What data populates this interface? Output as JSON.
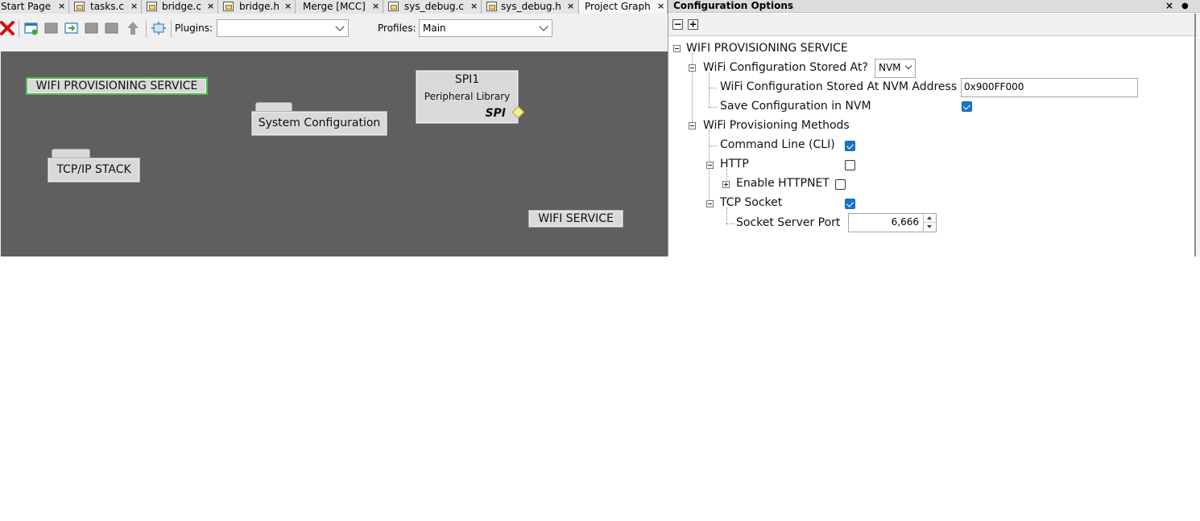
{
  "tabs": [
    {
      "label": "Start Page",
      "icon": "none",
      "active": false
    },
    {
      "label": "tasks.c",
      "icon": "c-file-icon",
      "active": false
    },
    {
      "label": "bridge.c",
      "icon": "c-file-icon",
      "active": false
    },
    {
      "label": "bridge.h",
      "icon": "h-file-icon",
      "active": false
    },
    {
      "label": "Merge [MCC]",
      "icon": "none",
      "active": false
    },
    {
      "label": "sys_debug.c",
      "icon": "c-file-icon",
      "active": false
    },
    {
      "label": "sys_debug.h",
      "icon": "h-file-icon",
      "active": false
    },
    {
      "label": "Project Graph",
      "icon": "none",
      "active": true
    }
  ],
  "tab_close_glyph": "×",
  "toolbar": {
    "plugins_label": "Plugins:",
    "plugins_value": "",
    "profiles_label": "Profiles:",
    "profiles_value": "Main"
  },
  "graph": {
    "wifi_prov": "WIFI PROVISIONING SERVICE",
    "sys_config": "System Configuration",
    "tcpip": "TCP/IP STACK",
    "spi_title": "SPI1",
    "spi_subtitle": "Peripheral Library",
    "spi_interface": "SPI",
    "wifi_service": "WIFI SERVICE"
  },
  "config_panel": {
    "title": "Configuration Options",
    "close_glyph": "×",
    "pin_glyph": "●",
    "collapse_all": "−",
    "expand_all": "+",
    "root": "WIFI PROVISIONING SERVICE",
    "stored_at_label": "WiFi Configuration Stored At?",
    "stored_at_value": "NVM",
    "nvm_address_label": "WiFi Configuration Stored At NVM Address",
    "nvm_address_value": "0x900FF000",
    "save_nvm_label": "Save Configuration in NVM",
    "save_nvm_checked": true,
    "methods_label": "WiFi Provisioning Methods",
    "cli_label": "Command Line (CLI)",
    "cli_checked": true,
    "http_label": "HTTP",
    "http_checked": false,
    "httpnet_label": "Enable HTTPNET",
    "httpnet_checked": false,
    "tcp_label": "TCP Socket",
    "tcp_checked": true,
    "port_label": "Socket Server Port",
    "port_value": "6,666"
  },
  "colors": {
    "canvas": "#5f5f5f",
    "node": "#d9d9d9",
    "selected_border": "#4bbf4b",
    "checkbox_on": "#1874cd",
    "connector": "#f5f08a"
  }
}
